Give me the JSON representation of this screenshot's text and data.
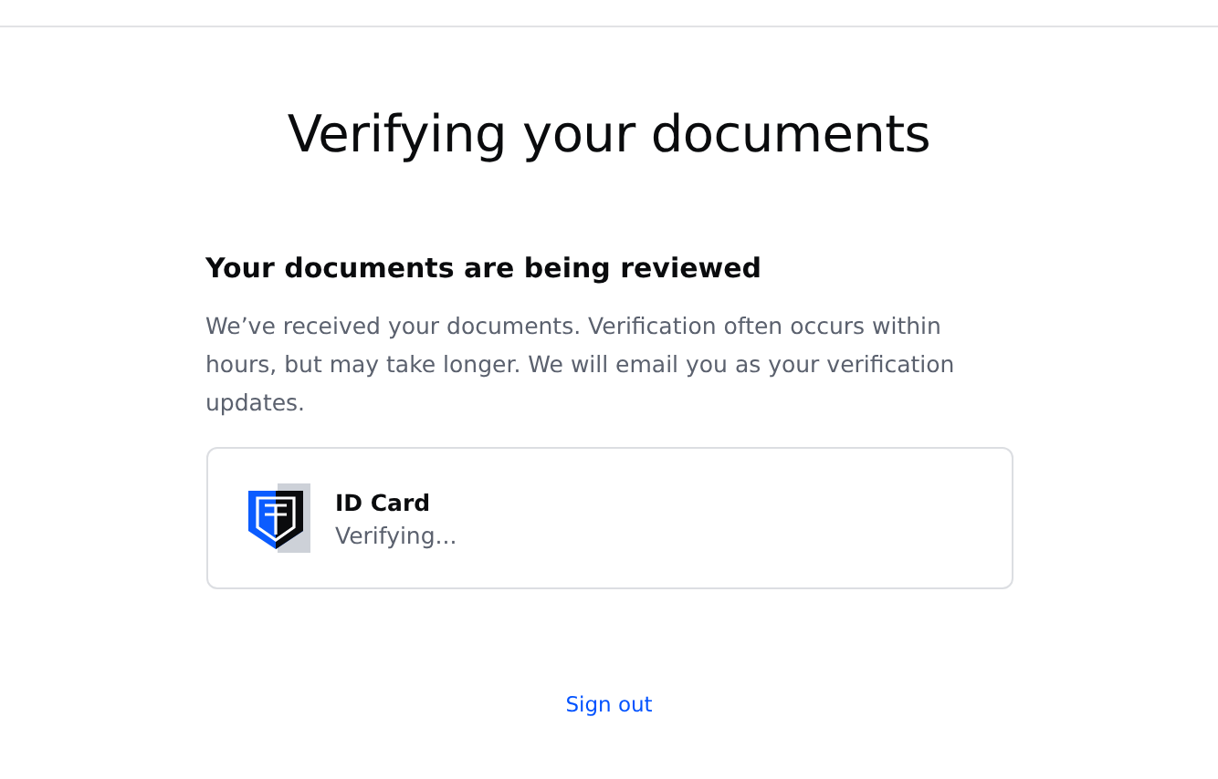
{
  "page_title": "Verifying your documents",
  "section_heading": "Your documents are being reviewed",
  "description": "We’ve received your documents. Verification often occurs within hours, but may take longer. We will email you as your verification updates.",
  "documents": [
    {
      "name": "ID Card",
      "status": "Verifying..."
    }
  ],
  "sign_out_link": "Sign out"
}
